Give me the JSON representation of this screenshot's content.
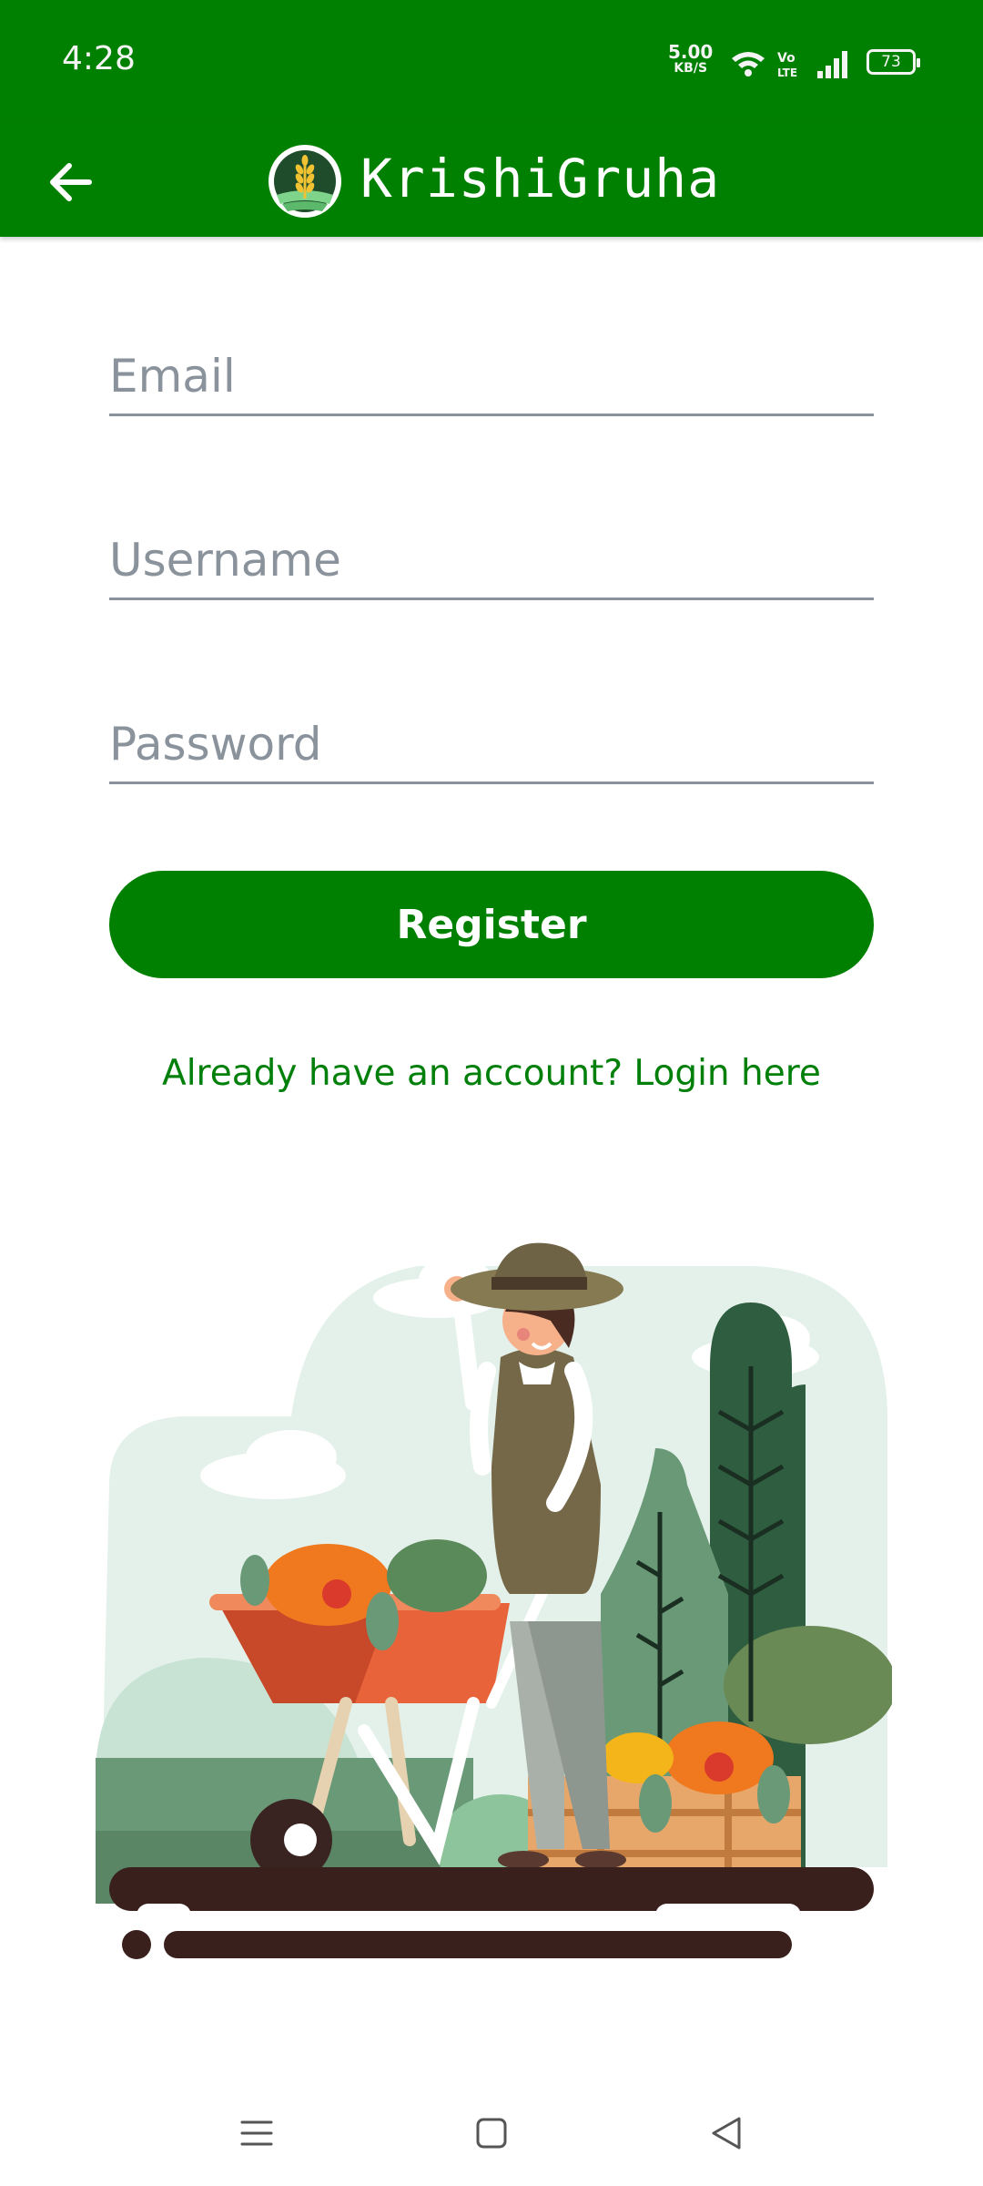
{
  "status_bar": {
    "time": "4:28",
    "net_speed": "5.00",
    "net_unit": "KB/S",
    "volte": "Vo LTE",
    "battery": "73"
  },
  "app_bar": {
    "title": "KrishiGruha",
    "back_icon": "arrow-left-icon",
    "logo_icon": "wheat-logo-icon"
  },
  "form": {
    "email": {
      "placeholder": "Email",
      "value": ""
    },
    "username": {
      "placeholder": "Username",
      "value": ""
    },
    "password": {
      "placeholder": "Password",
      "value": ""
    },
    "register_label": "Register",
    "login_link": "Already have an account? Login here"
  },
  "illustration": {
    "name": "farmer-with-wheelbarrow-illustration"
  },
  "nav_bar": {
    "menu_icon": "menu-icon",
    "home_icon": "home-square-icon",
    "back_icon": "back-triangle-icon"
  },
  "colors": {
    "primary": "#008000",
    "placeholder": "#8a939c",
    "link": "#00800a"
  }
}
